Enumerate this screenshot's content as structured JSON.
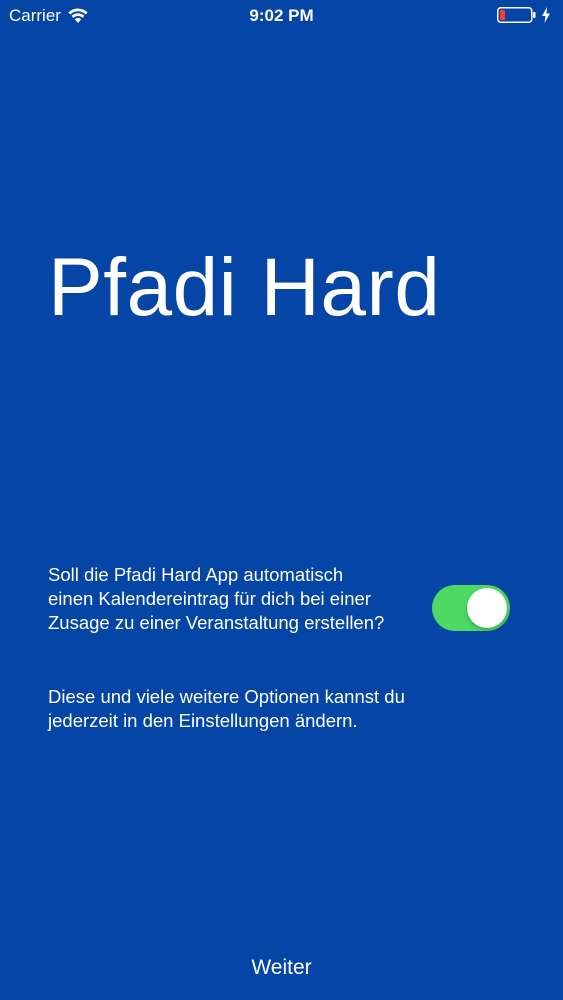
{
  "status_bar": {
    "carrier": "Carrier",
    "time": "9:02 PM"
  },
  "title": "Pfadi Hard",
  "calendar_option": {
    "question": "Soll die Pfadi Hard App automatisch einen Kalendereintrag für dich bei einer Zusage zu einer Veranstaltung erstellen?",
    "enabled": true
  },
  "info_text": "Diese und viele weitere Optionen kannst du jederzeit in den Einstellungen ändern.",
  "next_label": "Weiter",
  "colors": {
    "background": "#0545a5",
    "toggle_on": "#4cd964",
    "battery_low": "#ff3b30",
    "text": "#ffffff"
  },
  "icons": {
    "wifi": "wifi-icon",
    "battery": "battery-icon",
    "charging": "charging-bolt-icon"
  }
}
